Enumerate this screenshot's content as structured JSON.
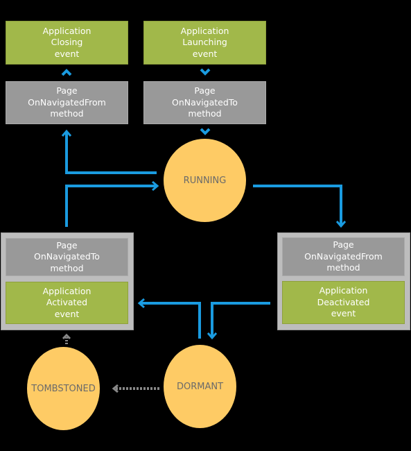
{
  "colors": {
    "event": "#a1b84a",
    "method": "#999999",
    "state": "#fecb65",
    "arrow": "#1a9be0",
    "dotted_arrow": "#888888"
  },
  "boxes": {
    "closing": "Application\nClosing\nevent",
    "launching": "Application\nLaunching\nevent",
    "nav_from_top": "Page\nOnNavigatedFrom\nmethod",
    "nav_to_top": "Page\nOnNavigatedTo\nmethod",
    "nav_to_left": "Page\nOnNavigatedTo\nmethod",
    "activated": "Application\nActivated\nevent",
    "nav_from_right": "Page\nOnNavigatedFrom\nmethod",
    "deactivated": "Application\nDeactivated\nevent"
  },
  "states": {
    "running": "RUNNING",
    "dormant": "DORMANT",
    "tombstoned": "TOMBSTONED"
  }
}
